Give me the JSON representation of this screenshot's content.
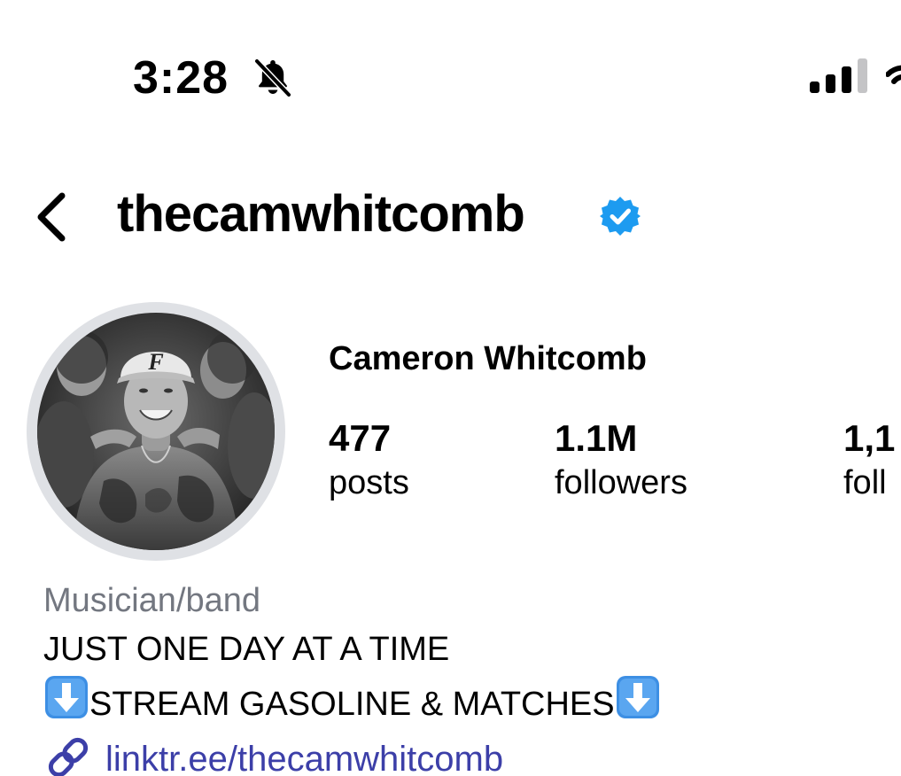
{
  "status_bar": {
    "time": "3:28",
    "bell_icon": "bell-slash-icon",
    "signal_icon": "cellular-signal-icon",
    "wifi_icon": "wifi-icon"
  },
  "header": {
    "back_icon": "chevron-left-icon",
    "username": "thecamwhitcomb",
    "verified_icon": "verified-badge-icon",
    "verified_color": "#1d9bf0"
  },
  "profile": {
    "full_name": "Cameron Whitcomb",
    "avatar_icon": "profile-photo",
    "stats": [
      {
        "value": "477",
        "label": "posts"
      },
      {
        "value": "1.1M",
        "label": "followers"
      },
      {
        "value": "1,1",
        "label": "foll"
      }
    ]
  },
  "bio": {
    "category": "Musician/band",
    "line1": "JUST ONE DAY AT A TIME",
    "line2": "STREAM GASOLINE & MATCHES",
    "arrow_icon": "down-arrow-emoji-icon",
    "link_icon": "link-icon",
    "link": "linktr.ee/thecamwhitcomb",
    "link_color": "#3c3fa8",
    "category_color": "#737780"
  }
}
